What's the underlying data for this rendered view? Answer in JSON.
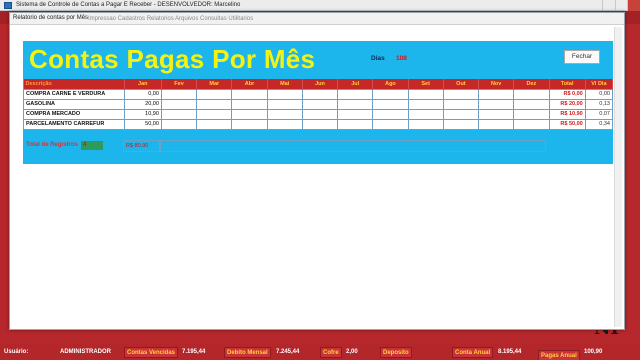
{
  "outer": {
    "title": "Sistema de Controle de Contas a Pagar E Receber - DESENVOLVEDOR: Marcelino",
    "logo_text": "NI"
  },
  "dialog": {
    "title": "Relatorio de contas por Mês",
    "menu_blur": "Impressao   Cadastros   Relatorios   Arquivos   Consultas   Utilitarios"
  },
  "header": {
    "title": "Contas Pagas Por Mês",
    "dias_label": "Dias",
    "dias_value": "108",
    "close_label": "Fechar"
  },
  "table": {
    "columns": [
      "Descrição",
      "Jan",
      "Fev",
      "Mar",
      "Abr",
      "Mai",
      "Jun",
      "Jul",
      "Ago",
      "Set",
      "Out",
      "Nov",
      "Dez",
      "Total",
      "Vl Dia"
    ],
    "rows": [
      {
        "desc": "COMPRA CARNE E VERDURA",
        "jan": "0,00",
        "total": "R$ 0,00",
        "vl_dia": "0,00"
      },
      {
        "desc": "GASOLINA",
        "jan": "20,00",
        "total": "R$ 20,00",
        "vl_dia": "0,13"
      },
      {
        "desc": "COMPRA MERCADO",
        "jan": "10,90",
        "total": "R$ 10,90",
        "vl_dia": "0,07"
      },
      {
        "desc": "PARCELAMENTO CARREFUR",
        "jan": "50,00",
        "total": "R$ 50,00",
        "vl_dia": "0,34"
      }
    ],
    "footer": {
      "total_label": "Total de Registros",
      "total_value": "4",
      "jan_footer": "R$ 80,90"
    }
  },
  "statusbar": {
    "usuario_label": "Usuário:",
    "usuario_value": "ADMINISTRADOR",
    "contas_vencidas_label": "Contas Vencidas",
    "contas_vencidas_value": "7.195,44",
    "debito_mensal_label": "Debito Mensal",
    "debito_mensal_value": "7.245,44",
    "cofre_label": "Cofre",
    "cofre_value": "2,00",
    "deposito_label": "Deposito",
    "conta_anual_label": "Conta Anual",
    "conta_anual_value": "8.195,44",
    "pagas_anual_label": "Pagas Anual",
    "pagas_anual_value": "100,90"
  },
  "colors": {
    "panel": "#1cb5ec",
    "header_bar": "#c62828",
    "title_yellow": "#f4f213",
    "app_bg": "#b7282c"
  }
}
